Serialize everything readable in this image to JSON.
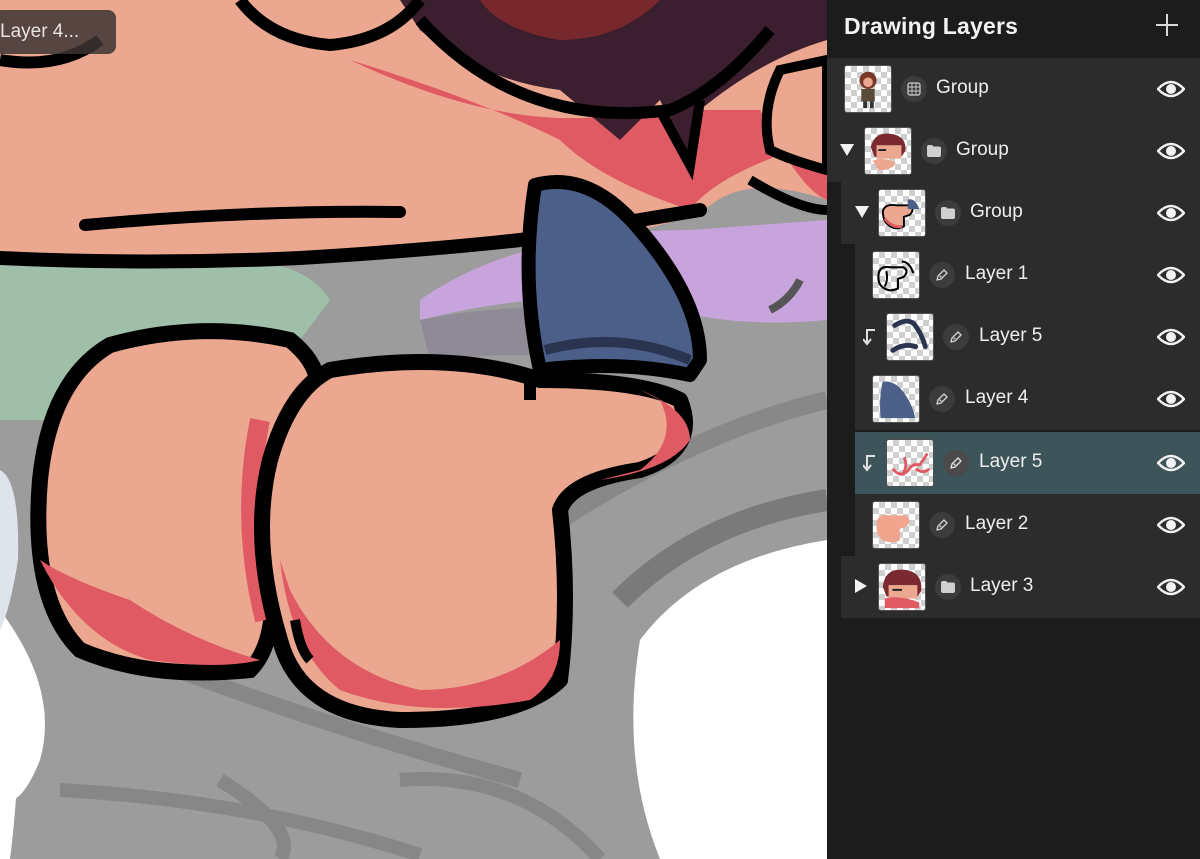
{
  "canvas": {
    "current_layer_tag": "Layer 4..."
  },
  "panel": {
    "title": "Drawing Layers",
    "layers": [
      {
        "label": "Group",
        "type": "group-grid"
      },
      {
        "label": "Group",
        "type": "group",
        "expanded": true
      },
      {
        "label": "Group",
        "type": "group",
        "expanded": true
      },
      {
        "label": "Layer 1",
        "type": "drawing"
      },
      {
        "label": "Layer 5",
        "type": "drawing",
        "clipped": true
      },
      {
        "label": "Layer 4",
        "type": "drawing"
      },
      {
        "label": "Layer 5",
        "type": "drawing",
        "clipped": true,
        "selected": true
      },
      {
        "label": "Layer 2",
        "type": "drawing"
      },
      {
        "label": "Layer 3",
        "type": "group",
        "expanded": false
      }
    ]
  },
  "colors": {
    "panel_background": "#1c1c1c",
    "row_background": "#2c2c2c",
    "selected_row": "#3e545b",
    "skin": "#eba790",
    "skin_shadow": "#e05a63",
    "hair": "#3c1f2e",
    "outline": "#000000",
    "blue_accent": "#4b5f88"
  },
  "icons": {
    "add": "plus-icon",
    "visibility": "eye-icon",
    "group": "folder-icon",
    "drawing": "pen-icon",
    "clipping": "clip-arrow-icon",
    "expand": "disclosure-triangle-icon"
  }
}
